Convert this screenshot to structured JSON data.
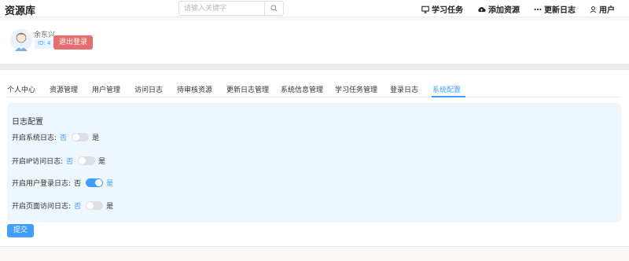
{
  "header": {
    "brand": "资源库",
    "search_placeholder": "请输入关键字",
    "nav": [
      {
        "label": "学习任务",
        "icon": "monitor-icon"
      },
      {
        "label": "添加资源",
        "icon": "cloud-upload-icon"
      },
      {
        "label": "更新日志",
        "icon": "more-dots-icon"
      },
      {
        "label": "用户",
        "icon": "user-icon"
      }
    ]
  },
  "profile": {
    "name": "余东兴",
    "id_label": "ID: 4",
    "logout_label": "退出登录"
  },
  "tabs": [
    {
      "label": "个人中心",
      "active": false
    },
    {
      "label": "资源管理",
      "active": false
    },
    {
      "label": "用户管理",
      "active": false
    },
    {
      "label": "访问日志",
      "active": false
    },
    {
      "label": "待审核资源",
      "active": false
    },
    {
      "label": "更新日志管理",
      "active": false
    },
    {
      "label": "系统信息管理",
      "active": false
    },
    {
      "label": "学习任务管理",
      "active": false
    },
    {
      "label": "登录日志",
      "active": false
    },
    {
      "label": "系统配置",
      "active": true
    }
  ],
  "log_config": {
    "title": "日志配置",
    "off_label": "否",
    "on_label": "是",
    "rows": [
      {
        "label": "开启系统日志:",
        "enabled": false
      },
      {
        "label": "开启IP访问日志:",
        "enabled": false
      },
      {
        "label": "开启用户登录日志:",
        "enabled": true
      },
      {
        "label": "开启页面访问日志:",
        "enabled": false
      }
    ]
  },
  "submit_label": "提交",
  "colors": {
    "accent": "#409eff",
    "danger": "#e66e6e",
    "panel_bg": "#eef6fe"
  }
}
